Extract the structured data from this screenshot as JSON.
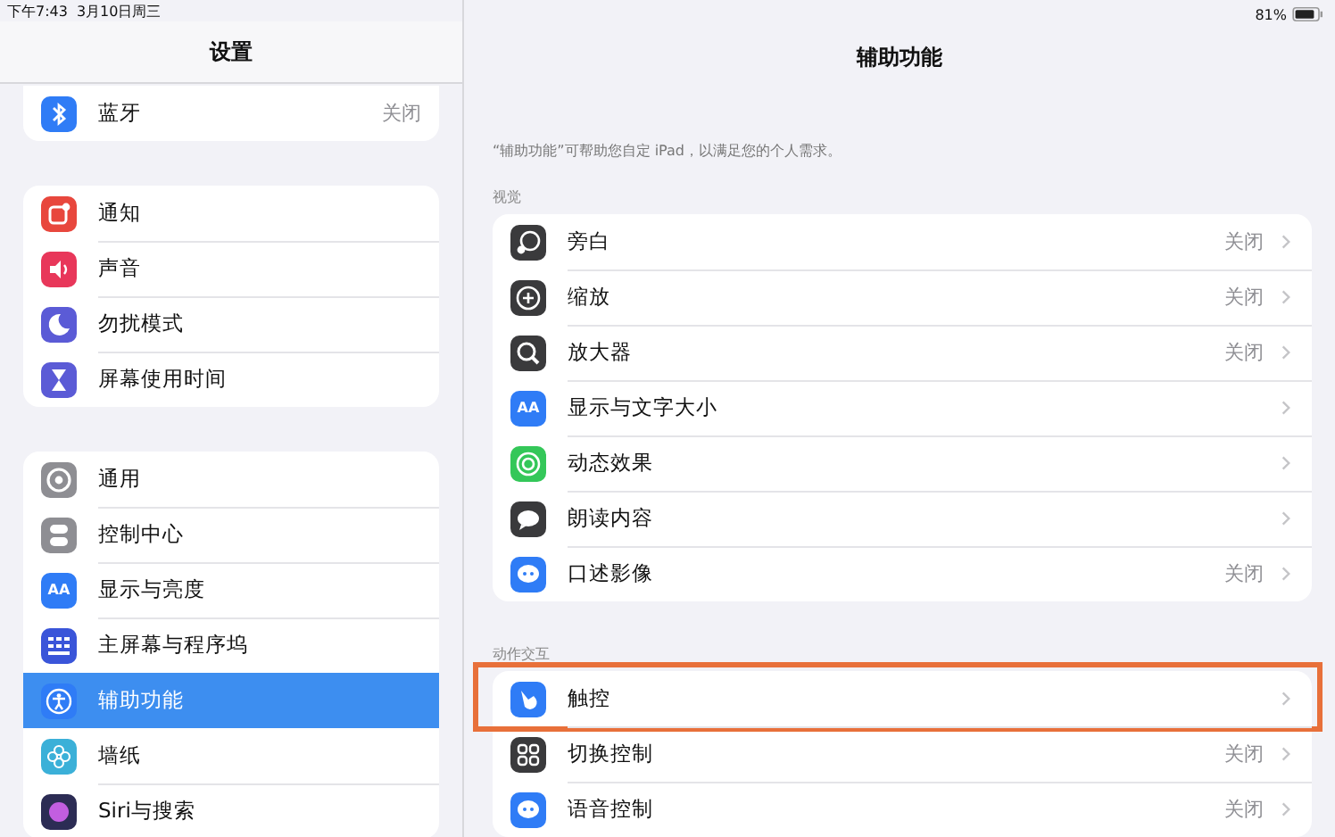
{
  "status_bar": {
    "time": "下午7:43",
    "date": "3月10日周三",
    "battery": "81%"
  },
  "sidebar": {
    "title": "设置",
    "groups": [
      [
        {
          "label": "蓝牙",
          "value": "关闭",
          "selected": false,
          "color": "#2f7cf6"
        }
      ],
      [
        {
          "label": "通知",
          "selected": false,
          "color": "#e8473d"
        },
        {
          "label": "声音",
          "selected": false,
          "color": "#e8375a"
        },
        {
          "label": "勿扰模式",
          "selected": false,
          "color": "#5b5bd6"
        },
        {
          "label": "屏幕使用时间",
          "selected": false,
          "color": "#5b5bd6"
        }
      ],
      [
        {
          "label": "通用",
          "selected": false,
          "color": "#8e8e93"
        },
        {
          "label": "控制中心",
          "selected": false,
          "color": "#8e8e93"
        },
        {
          "label": "显示与亮度",
          "selected": false,
          "color": "#2f7cf6",
          "icon_text": "AA"
        },
        {
          "label": "主屏幕与程序坞",
          "selected": false,
          "color": "#3a55d9"
        },
        {
          "label": "辅助功能",
          "selected": true,
          "color": "#2f7cf6"
        },
        {
          "label": "墙纸",
          "selected": false,
          "color": "#3bb0d8"
        },
        {
          "label": "Siri与搜索",
          "selected": false,
          "color": "#2c2c54"
        }
      ]
    ]
  },
  "detail": {
    "title": "辅助功能",
    "description": "“辅助功能”可帮助您自定 iPad，以满足您的个人需求。",
    "sections": [
      {
        "header": "视觉",
        "items": [
          {
            "label": "旁白",
            "value": "关闭",
            "highlighted": false,
            "color": "#3a3a3c"
          },
          {
            "label": "缩放",
            "value": "关闭",
            "highlighted": false,
            "color": "#3a3a3c"
          },
          {
            "label": "放大器",
            "value": "关闭",
            "highlighted": false,
            "color": "#3a3a3c"
          },
          {
            "label": "显示与文字大小",
            "highlighted": false,
            "color": "#2f7cf6",
            "icon_text": "AA"
          },
          {
            "label": "动态效果",
            "highlighted": false,
            "color": "#34c759"
          },
          {
            "label": "朗读内容",
            "highlighted": false,
            "color": "#3a3a3c"
          },
          {
            "label": "口述影像",
            "value": "关闭",
            "highlighted": false,
            "color": "#2f7cf6"
          }
        ]
      },
      {
        "header": "动作交互",
        "items": [
          {
            "label": "触控",
            "highlighted": true,
            "color": "#2f7cf6"
          },
          {
            "label": "切换控制",
            "value": "关闭",
            "highlighted": false,
            "color": "#3a3a3c"
          },
          {
            "label": "语音控制",
            "value": "关闭",
            "highlighted": false,
            "color": "#2f7cf6"
          }
        ]
      }
    ]
  }
}
